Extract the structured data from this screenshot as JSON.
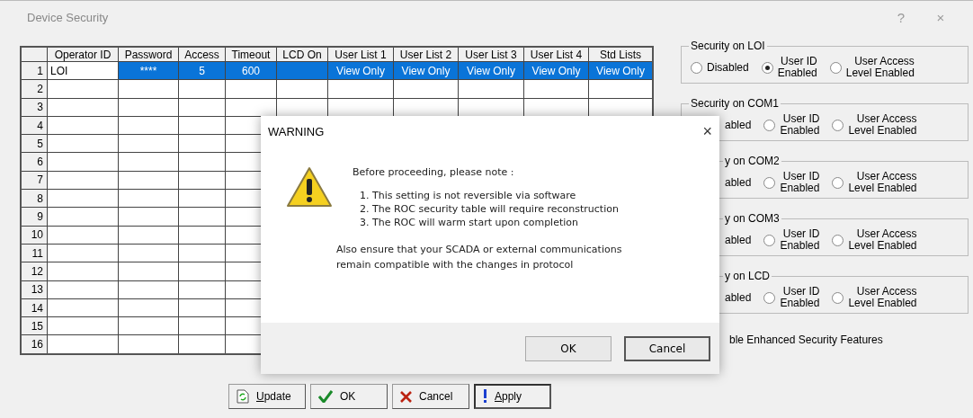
{
  "window": {
    "title": "Device Security",
    "help": "?",
    "close": "×"
  },
  "table": {
    "columns": [
      "Operator ID",
      "Password",
      "Access",
      "Timeout",
      "LCD On",
      "User List 1",
      "User List 2",
      "User List 3",
      "User List 4",
      "Std Lists"
    ],
    "rows": [
      {
        "number": "1",
        "selected": true,
        "cells": [
          "LOI",
          "****",
          "5",
          "600",
          null,
          "View Only",
          "View Only",
          "View Only",
          "View Only",
          "View Only"
        ]
      },
      {
        "number": "2",
        "selected": false
      },
      {
        "number": "3",
        "selected": false
      },
      {
        "number": "4",
        "selected": false
      },
      {
        "number": "5",
        "selected": false
      },
      {
        "number": "6",
        "selected": false
      },
      {
        "number": "7",
        "selected": false
      },
      {
        "number": "8",
        "selected": false
      },
      {
        "number": "9",
        "selected": false
      },
      {
        "number": "10",
        "selected": false
      },
      {
        "number": "11",
        "selected": false
      },
      {
        "number": "12",
        "selected": false
      },
      {
        "number": "13",
        "selected": false
      },
      {
        "number": "14",
        "selected": false
      },
      {
        "number": "15",
        "selected": false
      },
      {
        "number": "16",
        "selected": false
      }
    ]
  },
  "security_groups": [
    {
      "title": "Security on LOI",
      "title_covered": false,
      "options": [
        {
          "kind": "radio",
          "label": "Disabled",
          "selected": false
        },
        {
          "kind": "radio",
          "label": "User ID\nEnabled",
          "selected": true
        },
        {
          "kind": "radio",
          "label": "User Access\nLevel Enabled",
          "selected": false
        }
      ]
    },
    {
      "title": "Security on COM1",
      "title_covered": false,
      "options": [
        {
          "kind": "covered",
          "label": "abled"
        },
        {
          "kind": "radio",
          "label": "User ID\nEnabled",
          "selected": false
        },
        {
          "kind": "radio",
          "label": "User Access\nLevel Enabled",
          "selected": false
        }
      ]
    },
    {
      "title": "y on COM2",
      "title_covered": true,
      "options": [
        {
          "kind": "covered",
          "label": "abled"
        },
        {
          "kind": "radio",
          "label": "User ID\nEnabled",
          "selected": false
        },
        {
          "kind": "radio",
          "label": "User Access\nLevel Enabled",
          "selected": false
        }
      ]
    },
    {
      "title": "y on COM3",
      "title_covered": true,
      "options": [
        {
          "kind": "covered",
          "label": "abled"
        },
        {
          "kind": "radio",
          "label": "User ID\nEnabled",
          "selected": false
        },
        {
          "kind": "radio",
          "label": "User Access\nLevel Enabled",
          "selected": false
        }
      ]
    },
    {
      "title": "y on LCD",
      "title_covered": true,
      "options": [
        {
          "kind": "covered",
          "label": "abled"
        },
        {
          "kind": "radio",
          "label": "User ID\nEnabled",
          "selected": false
        },
        {
          "kind": "radio",
          "label": "User Access\nLevel Enabled",
          "selected": false
        }
      ]
    }
  ],
  "enhanced_security": {
    "label": "ble Enhanced Security Features"
  },
  "buttons": [
    {
      "kind": "update",
      "label": "Update",
      "mnemonic": true,
      "focused": false
    },
    {
      "kind": "ok",
      "label": "OK",
      "focused": false
    },
    {
      "kind": "cancel",
      "label": "Cancel",
      "focused": false
    },
    {
      "kind": "apply",
      "label": "Apply",
      "mnemonic": true,
      "focused": true
    }
  ],
  "dialog": {
    "title": "WARNING",
    "close": "×",
    "heading": "Before proceeding, please note :",
    "items": [
      "1. This setting is not reversible via software",
      "2. The ROC security table will require reconstruction",
      "3. The ROC will warm start upon completion"
    ],
    "note": "Also ensure that your SCADA or external communications\nremain compatible with the changes in protocol",
    "buttons": [
      {
        "label": "OK",
        "focused": false
      },
      {
        "label": "Cancel",
        "focused": true
      }
    ]
  }
}
